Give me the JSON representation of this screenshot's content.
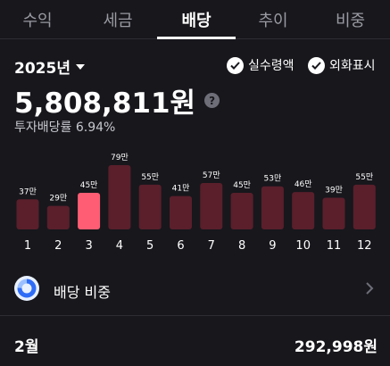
{
  "tabs": [
    {
      "label": "수익",
      "active": false
    },
    {
      "label": "세금",
      "active": false
    },
    {
      "label": "배당",
      "active": true
    },
    {
      "label": "추이",
      "active": false
    },
    {
      "label": "비중",
      "active": false
    }
  ],
  "year_selector": {
    "label": "2025년",
    "icon": "caret-down-icon"
  },
  "options": [
    {
      "label": "실수령액",
      "checked": true,
      "icon": "check-circle-icon"
    },
    {
      "label": "외화표시",
      "checked": true,
      "icon": "check-circle-icon"
    }
  ],
  "summary": {
    "total": "5,808,811원",
    "help_icon": "question-icon",
    "yield_text": "투자배당률 6.94%"
  },
  "chart_data": {
    "type": "bar",
    "categories": [
      "1",
      "2",
      "3",
      "4",
      "5",
      "6",
      "7",
      "8",
      "9",
      "10",
      "11",
      "12"
    ],
    "values": [
      37,
      29,
      45,
      79,
      55,
      41,
      57,
      45,
      53,
      46,
      39,
      55
    ],
    "data_labels": [
      "37만",
      "29만",
      "45만",
      "79만",
      "55만",
      "41만",
      "57만",
      "45만",
      "53만",
      "46만",
      "39만",
      "55만"
    ],
    "unit": "만",
    "highlight_index": 2,
    "colors": {
      "bar": "#5a1f2b",
      "highlight": "#ff5d73",
      "label": "#ffffff"
    }
  },
  "ratio_row": {
    "label": "배당 비중",
    "icon": "donut-chart-icon",
    "chevron": "chevron-right-icon"
  },
  "selected_month": {
    "label": "2월",
    "amount": "292,998원"
  }
}
